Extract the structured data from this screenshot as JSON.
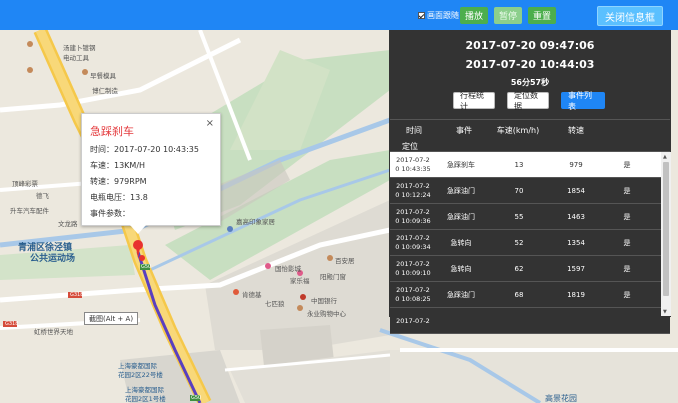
{
  "topbar": {
    "follow_label": "画面跟随",
    "play_label": "播放",
    "pause_label": "暂停",
    "reset_label": "重置",
    "close_info_label": "关闭信息框"
  },
  "popup": {
    "title": "急踩刹车",
    "time_line": "时间：2017-07-20 10:43:35",
    "speed_line": "车速：13KM/H",
    "rpm_line": "转速：979RPM",
    "voltage_line": "电瓶电压：13.8",
    "params_line": "事件参数：",
    "close_glyph": "×"
  },
  "panel": {
    "start_time": "2017-07-20 09:47:06",
    "end_time": "2017-07-20 10:44:03",
    "duration": "56分57秒",
    "btn_trip": "行程统计",
    "btn_position": "定位数据",
    "btn_events": "事件列表",
    "columns": {
      "time": "时间",
      "event": "事件",
      "speed": "车速(km/h)",
      "rpm": "转速",
      "locate": "定位"
    },
    "rows": [
      {
        "date": "2017-07-2",
        "time": "0 10:43:35",
        "event": "急踩刹车",
        "speed": "13",
        "rpm": "979",
        "yes": "是"
      },
      {
        "date": "2017-07-2",
        "time": "0 10:12:24",
        "event": "急踩油门",
        "speed": "70",
        "rpm": "1854",
        "yes": "是"
      },
      {
        "date": "2017-07-2",
        "time": "0 10:09:36",
        "event": "急踩油门",
        "speed": "55",
        "rpm": "1463",
        "yes": "是"
      },
      {
        "date": "2017-07-2",
        "time": "0 10:09:34",
        "event": "急转向",
        "speed": "52",
        "rpm": "1354",
        "yes": "是"
      },
      {
        "date": "2017-07-2",
        "time": "0 10:09:10",
        "event": "急转向",
        "speed": "62",
        "rpm": "1597",
        "yes": "是"
      },
      {
        "date": "2017-07-2",
        "time": "0 10:08:25",
        "event": "急踩油门",
        "speed": "68",
        "rpm": "1819",
        "yes": "是"
      },
      {
        "date": "2017-07-2",
        "time": "",
        "event": "",
        "speed": "",
        "rpm": "",
        "yes": ""
      }
    ]
  },
  "tooltip": "截图(Alt + A)",
  "map_labels": {
    "l1": "汤建卜镀钢",
    "l2": "电动工具",
    "l3": "早餐模具",
    "l4": "博仁制造",
    "l5": "青浦区徐泾镇",
    "l6": "公共运动场",
    "l7": "嘉高印象家居",
    "l8": "百安居",
    "l9": "国怡影城",
    "l10": "肯德基",
    "l11": "家乐福",
    "l12": "七匹狼",
    "l13": "中国银行",
    "l14": "永业购物中心",
    "l15": "上海豪都国际",
    "l16": "花园2区22号楼",
    "l17": "上海豪都国际",
    "l18": "花园2区1号楼",
    "l19": "虹桥世界天地",
    "l20": "高景花园",
    "l21": "G318",
    "l22": "G318",
    "l23": "阳殿门窗",
    "l24": "升车汽车配件",
    "l25": "文龙路",
    "l26": "顶峰彩票",
    "l27": "德飞",
    "l28": "G50",
    "l29": "G50"
  }
}
